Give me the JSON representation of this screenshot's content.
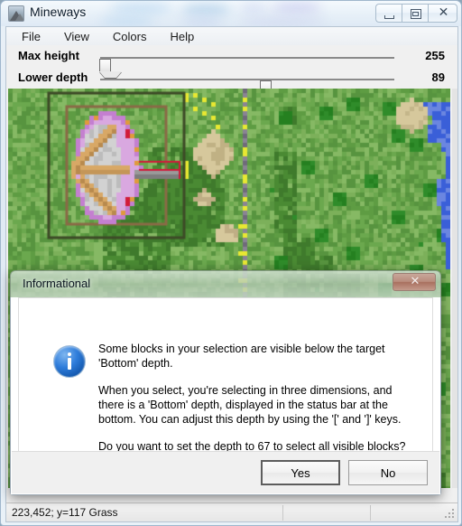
{
  "window": {
    "title": "Mineways",
    "icon": "mountain-icon",
    "controls": {
      "minimize": "minimize-icon",
      "restore": "restore-icon",
      "close_glyph": "✕"
    }
  },
  "menubar": {
    "items": [
      {
        "label": "File"
      },
      {
        "label": "View"
      },
      {
        "label": "Colors"
      },
      {
        "label": "Help"
      }
    ]
  },
  "sliders": [
    {
      "label": "Max height",
      "value": "255",
      "percent": 1.5
    },
    {
      "label": "Lower depth",
      "value": "89",
      "percent": 56.0
    }
  ],
  "statusbar": {
    "text": "223,452; y=117 Grass"
  },
  "dialog": {
    "title": "Informational",
    "icon": "info-icon",
    "close_glyph": "✕",
    "paragraphs": [
      "Some blocks in your selection are visible below the target 'Bottom' depth.",
      "When you select, you're selecting in three dimensions, and there is a 'Bottom' depth, displayed in the status bar at the bottom. You can adjust this depth by using the '[' and ']' keys.",
      "Do you want to set the depth to 67 to select all visible blocks?"
    ],
    "buttons": {
      "yes": "Yes",
      "no": "No"
    }
  },
  "map": {
    "colors": {
      "grass_light": "#7cb05a",
      "grass_mid": "#5e9c43",
      "grass_dark": "#3f7a2c",
      "leaves": "#2f8c2a",
      "water": "#3a5fd8",
      "water_light": "#6b86e0",
      "sand": "#d6c89c",
      "structure_pink": "#d9a8e0",
      "structure_stone": "#d2d2d2",
      "wood_tan": "#d8a866",
      "selection_outline": "#5a4a2e",
      "marker_red": "#d11a3a",
      "path_yellow": "#e8e832"
    }
  }
}
